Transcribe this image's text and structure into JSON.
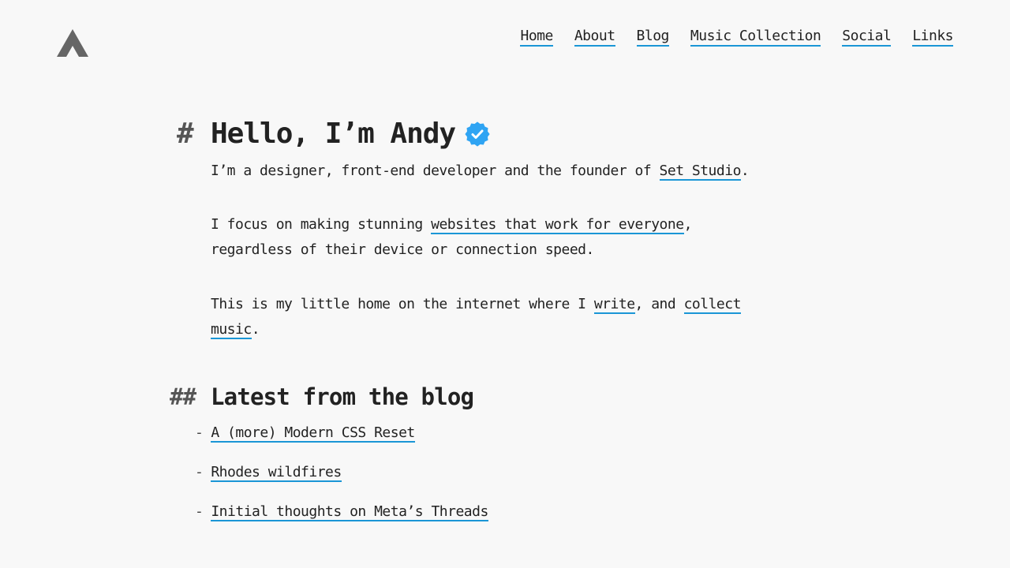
{
  "header": {
    "logo_icon": "triangle-a-logo",
    "nav": [
      {
        "label": "Home"
      },
      {
        "label": "About"
      },
      {
        "label": "Blog"
      },
      {
        "label": "Music Collection"
      },
      {
        "label": "Social"
      },
      {
        "label": "Links"
      }
    ]
  },
  "intro": {
    "hash": "#",
    "title": "Hello, I’m Andy",
    "badge_icon": "verified-badge-icon",
    "badge_color": "#2fa4f3",
    "p1": {
      "before": "I’m a designer, front-end developer and the founder of ",
      "link": "Set Studio",
      "after": "."
    },
    "p2": {
      "before": "I focus on making stunning ",
      "link": "websites that work for everyone",
      "after": ", regardless of their device or connection speed."
    },
    "p3": {
      "before": "This is my little home on the internet where I ",
      "link1": "write",
      "middle": ", and ",
      "link2": "collect music",
      "after": "."
    }
  },
  "blog": {
    "hash": "##",
    "title": "Latest from the blog",
    "bullet": "-",
    "posts": [
      {
        "title": "A (more) Modern CSS Reset"
      },
      {
        "title": "Rhodes wildfires"
      },
      {
        "title": "Initial thoughts on Meta’s Threads"
      }
    ]
  },
  "colors": {
    "background": "#f8f8f8",
    "text": "#222222",
    "link_underline": "#1a96d6",
    "hash": "#555555"
  }
}
